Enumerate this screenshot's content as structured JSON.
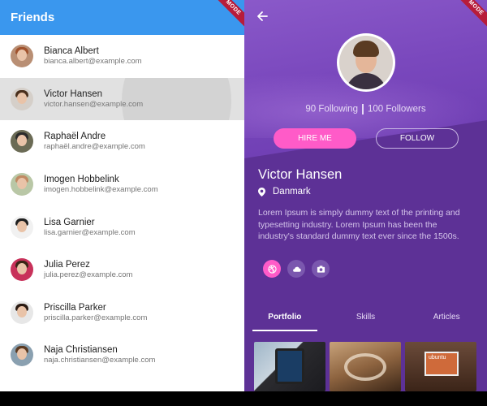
{
  "left": {
    "app_title": "Friends",
    "debug_banner": "MODE",
    "friends": [
      {
        "name": "Bianca Albert",
        "email": "bianca.albert@example.com",
        "hair": "#a0522d"
      },
      {
        "name": "Victor Hansen",
        "email": "victor.hansen@example.com",
        "hair": "#4a2f1c"
      },
      {
        "name": "Raphaël Andre",
        "email": "raphaël.andre@example.com",
        "hair": "#2b2b2b"
      },
      {
        "name": "Imogen Hobbelink",
        "email": "imogen.hobbelink@example.com",
        "hair": "#c08a63"
      },
      {
        "name": "Lisa Garnier",
        "email": "lisa.garnier@example.com",
        "hair": "#1f1f1f"
      },
      {
        "name": "Julia Perez",
        "email": "julia.perez@example.com",
        "hair": "#3a2516"
      },
      {
        "name": "Priscilla Parker",
        "email": "priscilla.parker@example.com",
        "hair": "#2a1a12"
      },
      {
        "name": "Naja Christiansen",
        "email": "naja.christiansen@example.com",
        "hair": "#5a3a22"
      }
    ],
    "selected_index": 1
  },
  "profile": {
    "debug_banner": "MODE",
    "back_icon": "arrow-left-icon",
    "following": "90 Following",
    "followers": "100 Followers",
    "hire_label": "HIRE ME",
    "follow_label": "FOLLOW",
    "name": "Victor Hansen",
    "location": "Danmark",
    "bio": "Lorem Ipsum is simply dummy text of the printing and typesetting industry. Lorem Ipsum has been the industry's standard dummy text ever since the 1500s.",
    "socials": [
      "dribbble-icon",
      "cloud-icon",
      "camera-icon"
    ],
    "tabs": [
      {
        "label": "Portfolio",
        "active": true
      },
      {
        "label": "Skills",
        "active": false
      },
      {
        "label": "Articles",
        "active": false
      }
    ],
    "gallery_labels": [
      "",
      "",
      "ubuntu"
    ]
  },
  "colors": {
    "appbar": "#3a97ee",
    "accent_pink": "#ff5bc8",
    "profile_bg": "#5d3196"
  }
}
